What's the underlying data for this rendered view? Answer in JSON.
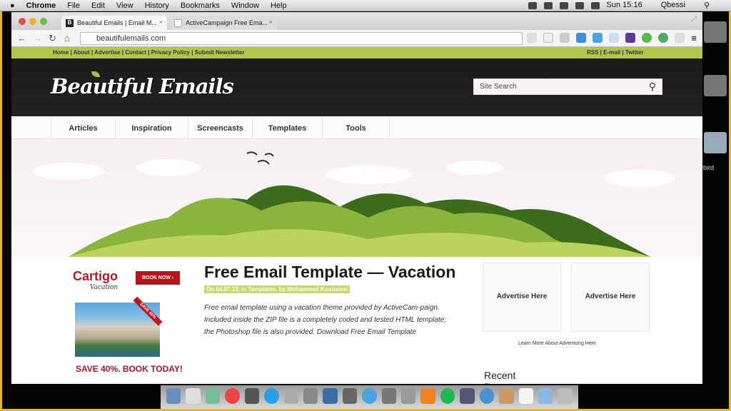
{
  "menubar": {
    "apple_icon": "apple-icon",
    "app": "Chrome",
    "items": [
      "File",
      "Edit",
      "View",
      "History",
      "Bookmarks",
      "Window",
      "Help"
    ],
    "clock": "Sun 15:16",
    "user": "Qbessi"
  },
  "browser": {
    "tabs": [
      {
        "label": "Beautiful Emails | Email M..."
      },
      {
        "label": "ActiveCampaign Free Ema..."
      }
    ],
    "url": "beautifulemails.com"
  },
  "site": {
    "topnav_left": "Home | About | Advertise | Contact | Privacy Policy | Submit Newsletter",
    "topnav_right": "RSS | E-mail | Twitter",
    "logo": "Beautiful Emails",
    "search_placeholder": "Site Search",
    "nav": [
      "Articles",
      "Inspiration",
      "Screencasts",
      "Templates",
      "Tools"
    ],
    "ad": {
      "brand": "Cartigo",
      "sub": "Vacation",
      "book": "BOOK NOW ›",
      "ribbon": "SAVE 40%",
      "save": "SAVE 40%. BOOK TODAY!"
    },
    "post": {
      "title": "Free Email Template — Vacation",
      "byline": "On 04.07.13, in Templates, by Mohammed Koubaissi",
      "excerpt": "Free email template using a vacation theme provided by ActiveCam-paign. Included inside the ZIP file is a completely coded and tested HTML template; the Photoshop file is also provided. Download Free Email Template"
    },
    "sidebar": {
      "ads": [
        "Advertise Here",
        "Advertise Here"
      ],
      "learn": "Learn More About Advertising Here",
      "recent": "Recent Posts"
    }
  },
  "desktop": {
    "icon_label": "rbird"
  },
  "colors": {
    "frame": "#e5b923",
    "green": "#b3c64a",
    "header": "#1b1b1b",
    "red": "#b8141e"
  }
}
